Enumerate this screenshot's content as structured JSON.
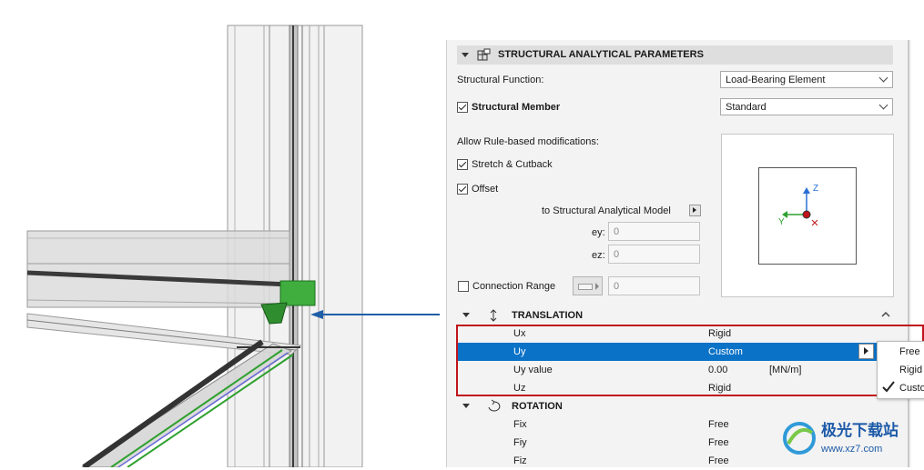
{
  "section": {
    "title": "STRUCTURAL ANALYTICAL PARAMETERS",
    "icon": "grid-settings-icon"
  },
  "structural_function": {
    "label": "Structural Function:",
    "value": "Load-Bearing Element"
  },
  "structural_member": {
    "label": "Structural Member",
    "checked": true,
    "value": "Standard"
  },
  "rule_mods": {
    "label": "Allow Rule-based modifications:"
  },
  "stretch": {
    "label": "Stretch & Cutback",
    "checked": true
  },
  "offset": {
    "label": "Offset",
    "checked": true
  },
  "to_model": {
    "label": "to Structural Analytical Model"
  },
  "ey": {
    "label": "ey:",
    "value": "0"
  },
  "ez": {
    "label": "ez:",
    "value": "0"
  },
  "connection_range": {
    "label": "Connection Range",
    "checked": false,
    "value": "0"
  },
  "preview": {
    "axis_z": "Z",
    "axis_y": "Y"
  },
  "translation": {
    "title": "TRANSLATION",
    "rows": [
      {
        "name": "Ux",
        "value": "Rigid",
        "unit": ""
      },
      {
        "name": "Uy",
        "value": "Custom",
        "unit": ""
      },
      {
        "name": "Uy value",
        "value": "0.00",
        "unit": "[MN/m]"
      },
      {
        "name": "Uz",
        "value": "Rigid",
        "unit": ""
      }
    ]
  },
  "rotation": {
    "title": "ROTATION",
    "rows": [
      {
        "name": "Fix",
        "value": "Free"
      },
      {
        "name": "Fiy",
        "value": "Free"
      },
      {
        "name": "Fiz",
        "value": "Free"
      }
    ]
  },
  "popup": {
    "items": [
      "Free",
      "Rigid",
      "Custo"
    ],
    "checked_index": 2
  },
  "watermark": {
    "text": "极光下载站",
    "url": "www.xz7.com"
  },
  "colors": {
    "selection": "#0a72c7",
    "highlight_border": "#c0141c",
    "arrow": "#1f5fa8",
    "green": "#2fa02f"
  }
}
